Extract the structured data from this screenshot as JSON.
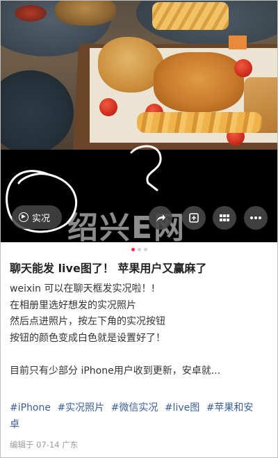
{
  "post": {
    "live_label": "实况",
    "watermark": "绍兴E网",
    "title": "聊天能发 live图了！ 苹果用户又赢麻了",
    "body_lines": [
      "weixin 可以在聊天框发实况啦！!",
      "在相册里选好想发的实况照片",
      "然后点进照片，按左下角的实况按钮",
      "按钮的颜色变成白色就是设置好了！",
      "",
      "目前只有少部分 iPhone用户收到更新，安卓就..."
    ],
    "tags_line1": [
      "#iPhone",
      "#实况照片",
      "#微信实况",
      "#live图",
      "#苹果和安"
    ],
    "tags_line2": [
      "卓"
    ],
    "meta": "编辑于 07-14 广东"
  },
  "pagination": {
    "total": 3,
    "active_index": 0
  },
  "colors": {
    "accent_dot": "#ff2442",
    "tag": "#3a5f97",
    "meta": "#9a9a9a"
  },
  "icons": [
    "live-play-icon",
    "share-icon",
    "plus-icon",
    "grid-icon",
    "more-icon"
  ]
}
